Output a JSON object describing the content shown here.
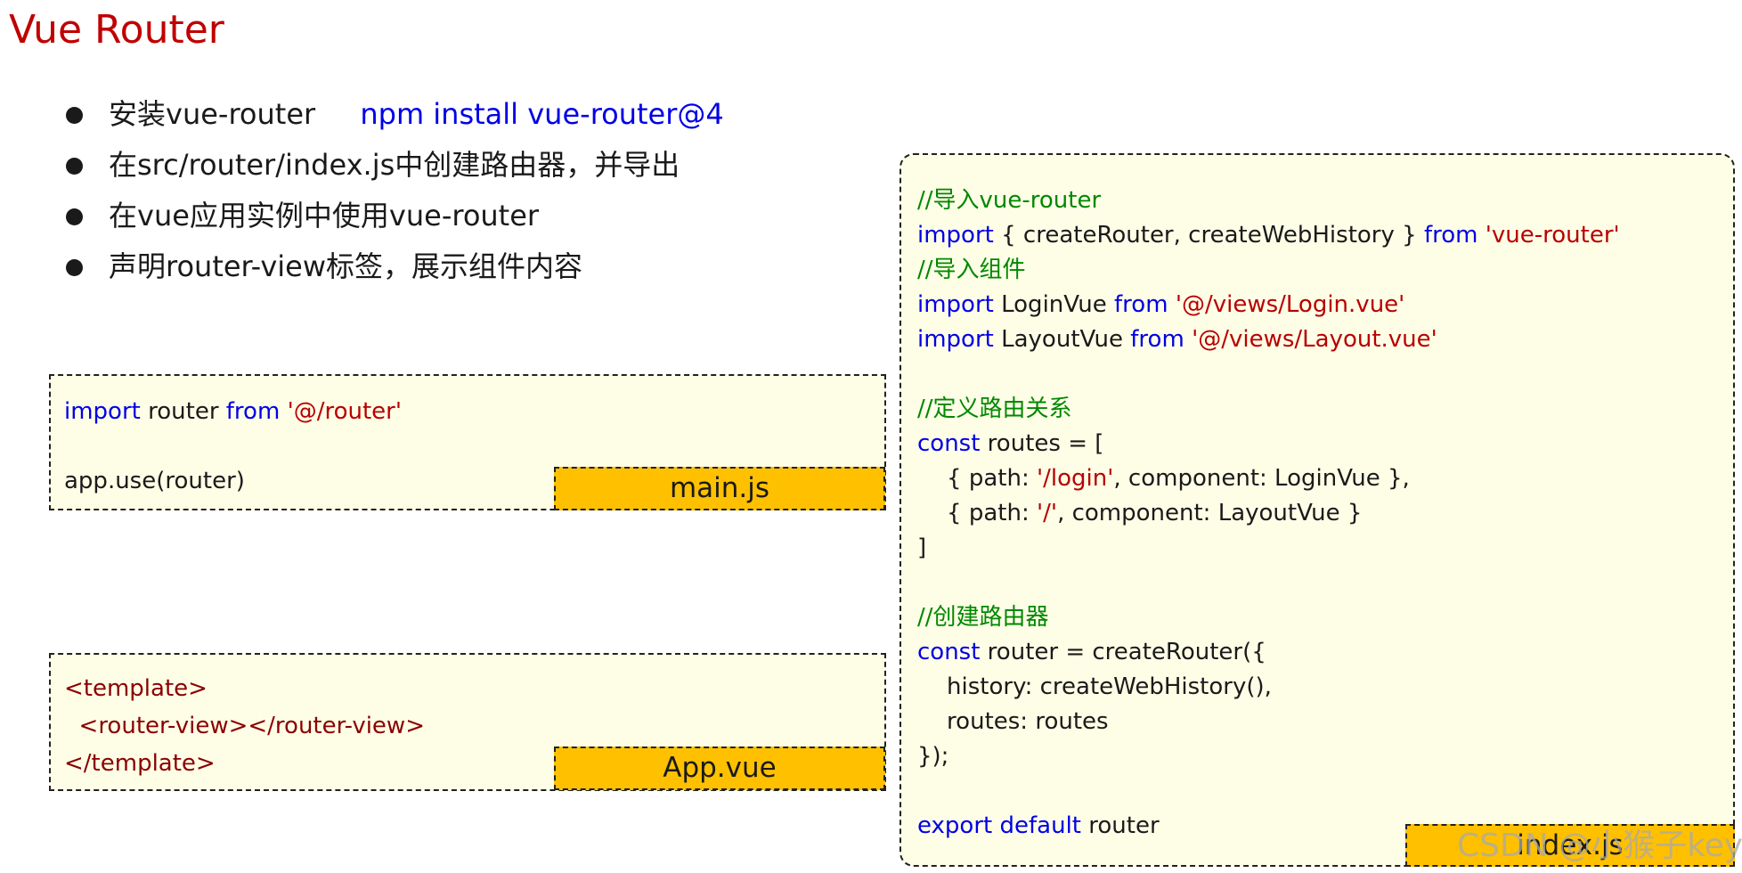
{
  "title": "Vue Router",
  "bullets": [
    {
      "text": "安装vue-router",
      "command": "npm install vue-router@4"
    },
    {
      "text": "在src/router/index.js中创建路由器，并导出"
    },
    {
      "text": "在vue应用实例中使用vue-router"
    },
    {
      "text": "声明router-view标签，展示组件内容"
    }
  ],
  "main_js": {
    "label": "main.js",
    "lines": [
      [
        {
          "t": "import",
          "c": "kw"
        },
        {
          "t": " router "
        },
        {
          "t": "from",
          "c": "kw"
        },
        {
          "t": " "
        },
        {
          "t": "'@/router'",
          "c": "str"
        }
      ],
      [],
      [
        {
          "t": "app.use(router)"
        }
      ]
    ]
  },
  "app_vue": {
    "label": "App.vue",
    "lines": [
      [
        {
          "t": "<template>",
          "c": "tag"
        }
      ],
      [
        {
          "t": "  "
        },
        {
          "t": "<router-view></router-view>",
          "c": "tag"
        }
      ],
      [
        {
          "t": "</template>",
          "c": "tag"
        }
      ]
    ]
  },
  "index_js": {
    "label": "index.js",
    "lines": [
      [
        {
          "t": "//导入vue-router",
          "c": "cm"
        }
      ],
      [
        {
          "t": "import",
          "c": "kw"
        },
        {
          "t": " { createRouter, createWebHistory } "
        },
        {
          "t": "from",
          "c": "kw"
        },
        {
          "t": " "
        },
        {
          "t": "'vue-router'",
          "c": "str"
        }
      ],
      [
        {
          "t": "//导入组件",
          "c": "cm"
        }
      ],
      [
        {
          "t": "import",
          "c": "kw"
        },
        {
          "t": " LoginVue "
        },
        {
          "t": "from",
          "c": "kw"
        },
        {
          "t": " "
        },
        {
          "t": "'@/views/Login.vue'",
          "c": "str"
        }
      ],
      [
        {
          "t": "import",
          "c": "kw"
        },
        {
          "t": " LayoutVue "
        },
        {
          "t": "from",
          "c": "kw"
        },
        {
          "t": " "
        },
        {
          "t": "'@/views/Layout.vue'",
          "c": "str"
        }
      ],
      [],
      [
        {
          "t": "//定义路由关系",
          "c": "cm"
        }
      ],
      [
        {
          "t": "const",
          "c": "kw"
        },
        {
          "t": " routes = ["
        }
      ],
      [
        {
          "t": "    { path: "
        },
        {
          "t": "'/login'",
          "c": "str"
        },
        {
          "t": ", component: LoginVue },"
        }
      ],
      [
        {
          "t": "    { path: "
        },
        {
          "t": "'/'",
          "c": "str"
        },
        {
          "t": ", component: LayoutVue }"
        }
      ],
      [
        {
          "t": "]"
        }
      ],
      [],
      [
        {
          "t": "//创建路由器",
          "c": "cm"
        }
      ],
      [
        {
          "t": "const",
          "c": "kw"
        },
        {
          "t": " router = createRouter({"
        }
      ],
      [
        {
          "t": "    history: createWebHistory(),"
        }
      ],
      [
        {
          "t": "    routes: routes"
        }
      ],
      [
        {
          "t": "});"
        }
      ],
      [],
      [
        {
          "t": "export",
          "c": "kw"
        },
        {
          "t": " "
        },
        {
          "t": "default",
          "c": "kw"
        },
        {
          "t": " router"
        }
      ]
    ]
  },
  "watermark": "CSDN @小猴子key",
  "colors": {
    "title": "#c00000",
    "keyword": "#0000e6",
    "string": "#b80000",
    "comment": "#008800",
    "tag": "#8b0000",
    "label_bg": "#ffc000",
    "box_bg": "#fefee7"
  }
}
